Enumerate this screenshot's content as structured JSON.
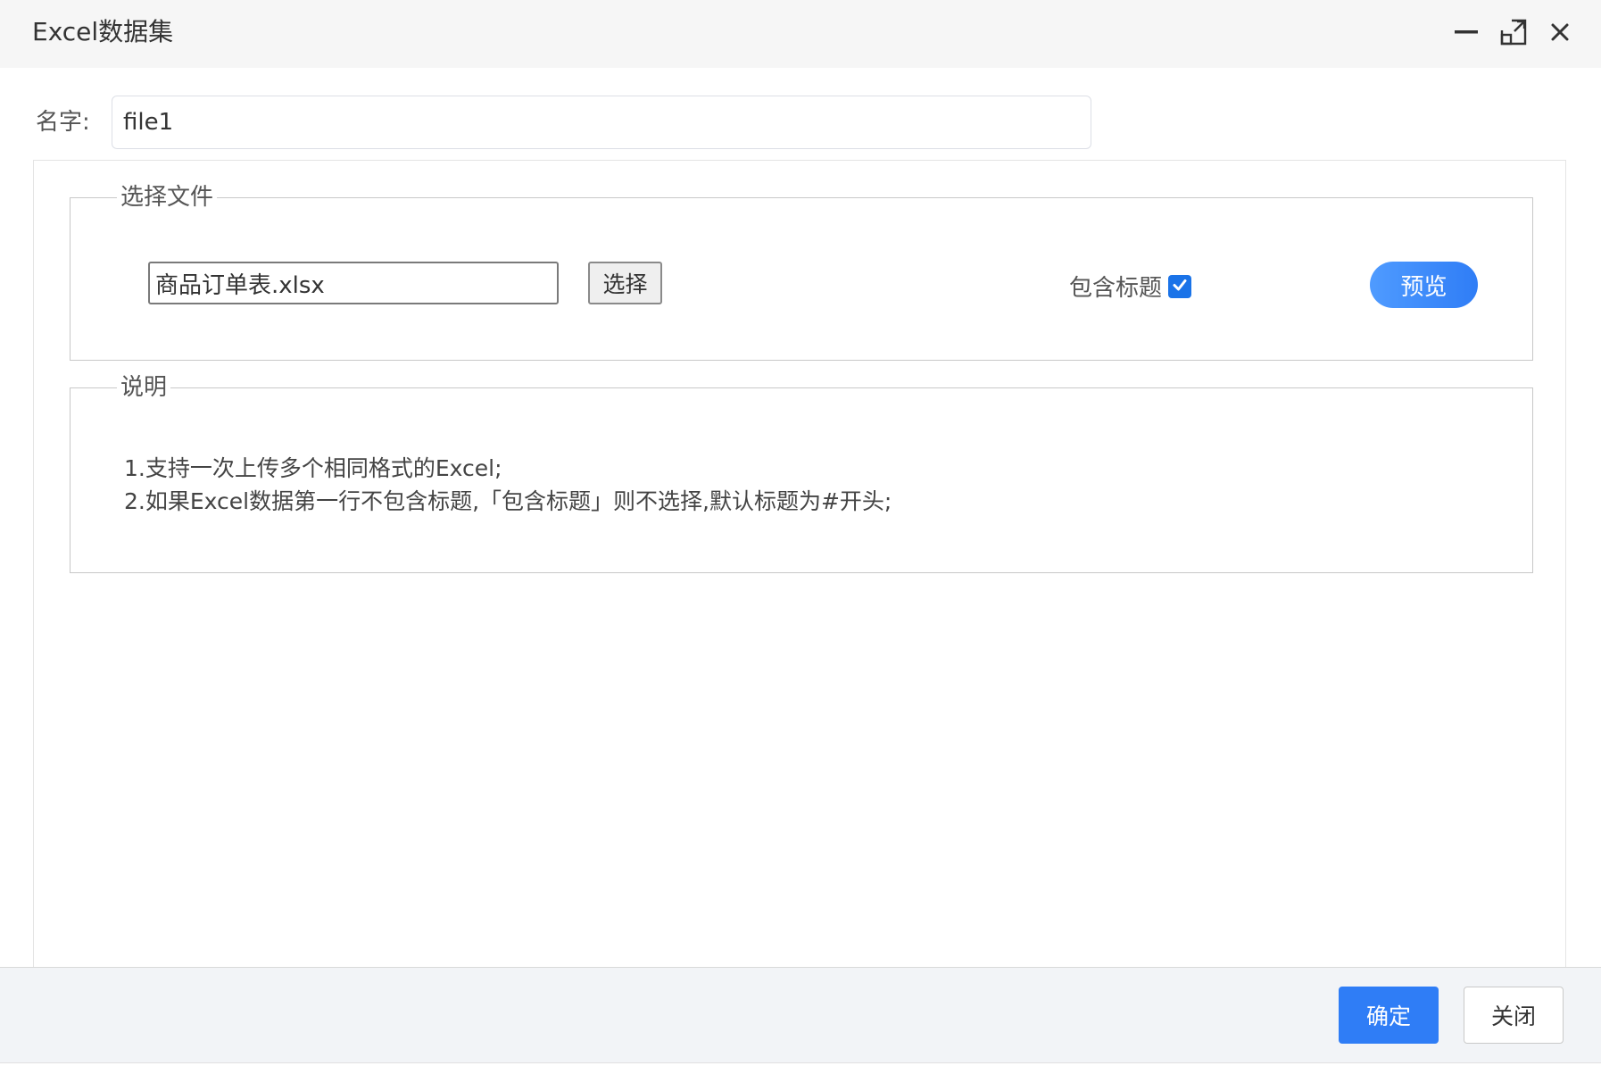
{
  "window": {
    "title": "Excel数据集",
    "controls": [
      "minimize-icon",
      "maximize-icon",
      "close-icon"
    ]
  },
  "form": {
    "name_label": "名字:",
    "name_value": "file1"
  },
  "file_section": {
    "legend": "选择文件",
    "file_value": "商品订单表.xlsx",
    "choose_label": "选择",
    "include_header_label": "包含标题",
    "include_header_checked": true,
    "preview_label": "预览"
  },
  "description": {
    "legend": "说明",
    "lines": [
      "1.支持一次上传多个相同格式的Excel;",
      "2.如果Excel数据第一行不包含标题,「包含标题」则不选择,默认标题为#开头;"
    ]
  },
  "footer": {
    "ok_label": "确定",
    "close_label": "关闭"
  },
  "colors": {
    "accent": "#2f7df6",
    "checkbox": "#1a73e8",
    "titlebar_bg": "#f6f6f6",
    "footer_bg": "#f2f4f7"
  }
}
